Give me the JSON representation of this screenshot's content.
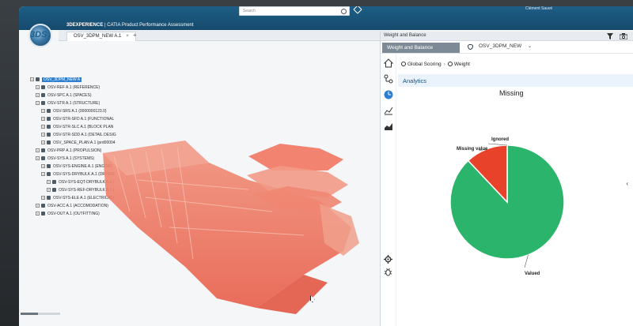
{
  "app": {
    "brand": "3DS",
    "title_prefix": "3DEXPERIENCE",
    "title_separator": "|",
    "title_rest": "CATIA Product Performance Assessment",
    "search_placeholder": "Search",
    "user": "Clément Sauvé"
  },
  "tabs": [
    {
      "label": "OSV_3DPM_NEW A.1"
    }
  ],
  "tree": [
    {
      "label": "OSV_3DPM_NEW A",
      "level": 0,
      "selected": true
    },
    {
      "label": "OSV-REF A.1 (REFERENCE)",
      "level": 1
    },
    {
      "label": "OSV-SPC A.1 (SPACES)",
      "level": 1
    },
    {
      "label": "OSV-STR A.1 (STRUCTURE)",
      "level": 1
    },
    {
      "label": "OSV-SRS A.1 (0000000123.0)",
      "level": 2
    },
    {
      "label": "OSV-STR-SFD A.1 (FUNCTIONAL",
      "level": 2
    },
    {
      "label": "OSV-STR-SLC A.1 (BLOCK PLAN",
      "level": 2
    },
    {
      "label": "OSV-STR-SDD A.1 (DETAIL DESIG",
      "level": 2
    },
    {
      "label": "OSV_SPACE_PLAN A.1 (prd00004",
      "level": 2
    },
    {
      "label": "OSV-PRP A.1 (PROPULSION)",
      "level": 1
    },
    {
      "label": "OSV-SYS A.1 (SYSTEMS)",
      "level": 1
    },
    {
      "label": "OSV-SYS-ENGINE A.1 (ENGINE)",
      "level": 2
    },
    {
      "label": "OSV-SYS-DRYBULK A.1 (DRYBUL",
      "level": 2
    },
    {
      "label": "OSV-SYS-EQT-DRYBULK A.1 (",
      "level": 3
    },
    {
      "label": "OSV-SYS-REF-DRYBULK A.1 (",
      "level": 3
    },
    {
      "label": "OSV-SYS-ELE A.1 (ELECTRICAL)",
      "level": 2
    },
    {
      "label": "OSV-ACC A.1 (ACCOMODATION)",
      "level": 1
    },
    {
      "label": "OSV-OUT A.1 (OUTFITTING)",
      "level": 1
    }
  ],
  "panel": {
    "header_title": "Weight and Balance",
    "tab_label": "Weight and Balance",
    "dataset": "OSV_3DPM_NEW",
    "crumb_1": "Global Scoring",
    "crumb_2": "Weight",
    "analytics_label": "Analytics",
    "icons": [
      "home-icon",
      "tree-icon",
      "clock-icon",
      "line-chart-icon",
      "area-chart-icon",
      "gear-icon",
      "bug-icon",
      "filter-icon",
      "camera-icon"
    ]
  },
  "chart_data": {
    "type": "pie",
    "title": "Missing",
    "labels": [
      "Valued",
      "Missing value",
      "Ignored"
    ],
    "values": [
      88,
      12,
      0
    ],
    "colors": [
      "#2bb46b",
      "#e8432a",
      "#f0a030"
    ]
  },
  "colors": {
    "topbar": "#1e5e86",
    "accent": "#2f7fd1",
    "ship": "#ea6a55"
  }
}
